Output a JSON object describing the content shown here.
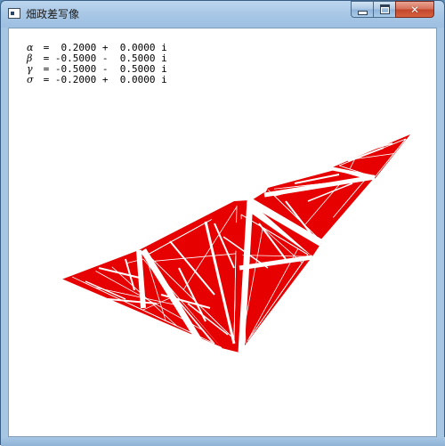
{
  "window": {
    "title": "畑政差写像",
    "controls": {
      "minimize_icon": "minimize-icon",
      "maximize_icon": "maximize-icon",
      "close_icon": "close-icon",
      "close_glyph": "✕"
    }
  },
  "parameters": [
    {
      "symbol": "α",
      "value": " =  0.2000 +  0.0000 i"
    },
    {
      "symbol": "β",
      "value": " = -0.5000 -  0.5000 i"
    },
    {
      "symbol": "γ",
      "value": " = -0.5000 -  0.5000 i"
    },
    {
      "symbol": "σ",
      "value": " = -0.2000 +  0.0000 i"
    }
  ],
  "fractal": {
    "fill_color": "#e60000",
    "background_color": "#ffffff"
  },
  "colors": {
    "title_bar": "#a9c8e6",
    "close_button": "#c2462b"
  }
}
